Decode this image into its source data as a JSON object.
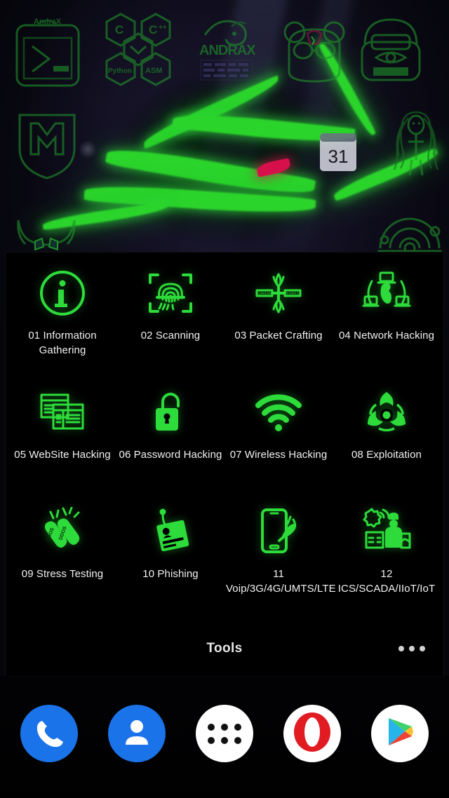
{
  "colors": {
    "neon_green": "#2ddc3b",
    "wallpaper_icon_green": "#1f8f2a",
    "panel_background": "#000000",
    "label_text": "#f2f2f2",
    "dock_blue": "#1a73e8",
    "opera_red": "#e11b22",
    "dragon_eye_red": "#d6104a"
  },
  "wallpaper": {
    "name": "andrax-dragon-wallpaper",
    "icons": [
      {
        "name": "andrax-terminal-icon",
        "label": "AndraX"
      },
      {
        "name": "code-languages-hex-icon",
        "labels": [
          "C",
          "C++",
          "Python",
          "ASM"
        ]
      },
      {
        "name": "andrax-dragon-logo-icon",
        "label": "ANDRAX"
      },
      {
        "name": "bear-mascot-icon",
        "label": ""
      },
      {
        "name": "gas-mask-icon",
        "label": ""
      },
      {
        "name": "metasploit-shield-icon",
        "label": ""
      },
      {
        "name": "devil-face-icon",
        "label": ""
      },
      {
        "name": "calendar-icon",
        "label": "31"
      },
      {
        "name": "medusa-figure-icon",
        "label": ""
      },
      {
        "name": "circuit-chip-icon",
        "label": ""
      }
    ]
  },
  "folder": {
    "title": "Tools",
    "more_label": "•••",
    "items": [
      {
        "index": "01",
        "label": "01 Information Gathering",
        "icon": "info-circle-icon"
      },
      {
        "index": "02",
        "label": "02 Scanning",
        "icon": "fingerprint-scan-icon"
      },
      {
        "index": "03",
        "label": "03 Packet Crafting",
        "icon": "packet-crafting-icon"
      },
      {
        "index": "04",
        "label": "04 Network Hacking",
        "icon": "network-globe-icon"
      },
      {
        "index": "05",
        "label": "05 WebSite Hacking",
        "icon": "browser-windows-icon"
      },
      {
        "index": "06",
        "label": "06 Password Hacking",
        "icon": "padlock-open-icon"
      },
      {
        "index": "07",
        "label": "07 Wireless Hacking",
        "icon": "wifi-signal-icon"
      },
      {
        "index": "08",
        "label": "08 Exploitation",
        "icon": "biohazard-icon"
      },
      {
        "index": "09",
        "label": "09 Stress Testing",
        "icon": "bombs-icon"
      },
      {
        "index": "10",
        "label": "10 Phishing",
        "icon": "phishing-hook-id-icon"
      },
      {
        "index": "11",
        "label": "11 Voip/3G/4G/UMTS/LTE",
        "icon": "phone-satellite-icon"
      },
      {
        "index": "12",
        "label": "12 ICS/SCADA/IIoT/IoT",
        "icon": "industrial-worker-icon"
      }
    ]
  },
  "dock": {
    "items": [
      {
        "name": "dock-phone",
        "label": "Phone",
        "icon": "phone-handset-icon"
      },
      {
        "name": "dock-contacts",
        "label": "Contacts",
        "icon": "person-icon"
      },
      {
        "name": "dock-app-drawer",
        "label": "All apps",
        "icon": "app-drawer-dots-icon"
      },
      {
        "name": "dock-opera",
        "label": "Opera",
        "icon": "opera-o-icon"
      },
      {
        "name": "dock-play-store",
        "label": "Play Store",
        "icon": "play-store-triangle-icon"
      }
    ]
  }
}
